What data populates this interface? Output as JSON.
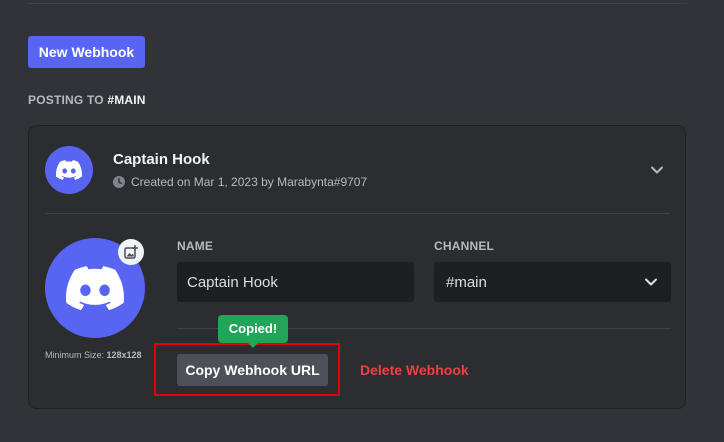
{
  "toolbar": {
    "new_webhook_label": "New Webhook"
  },
  "posting": {
    "prefix": "POSTING TO ",
    "channel": "#MAIN"
  },
  "webhook": {
    "name": "Captain Hook",
    "created": "Created on Mar 1, 2023 by Marabynta#9707",
    "min_size_prefix": "Minimum Size: ",
    "min_size_value": "128x128",
    "fields": {
      "name_label": "NAME",
      "name_value": "Captain Hook",
      "channel_label": "CHANNEL",
      "channel_value": "#main"
    },
    "actions": {
      "tooltip": "Copied!",
      "copy_label": "Copy Webhook URL",
      "delete_label": "Delete Webhook"
    }
  },
  "colors": {
    "background": "#313338",
    "card": "#2b2d31",
    "accent": "#5865f2",
    "success": "#23a559",
    "danger": "#f23f43",
    "highlight": "#e0030d"
  },
  "icons": [
    "discord-logo-icon",
    "clock-icon",
    "chevron-down-icon",
    "image-upload-icon"
  ]
}
